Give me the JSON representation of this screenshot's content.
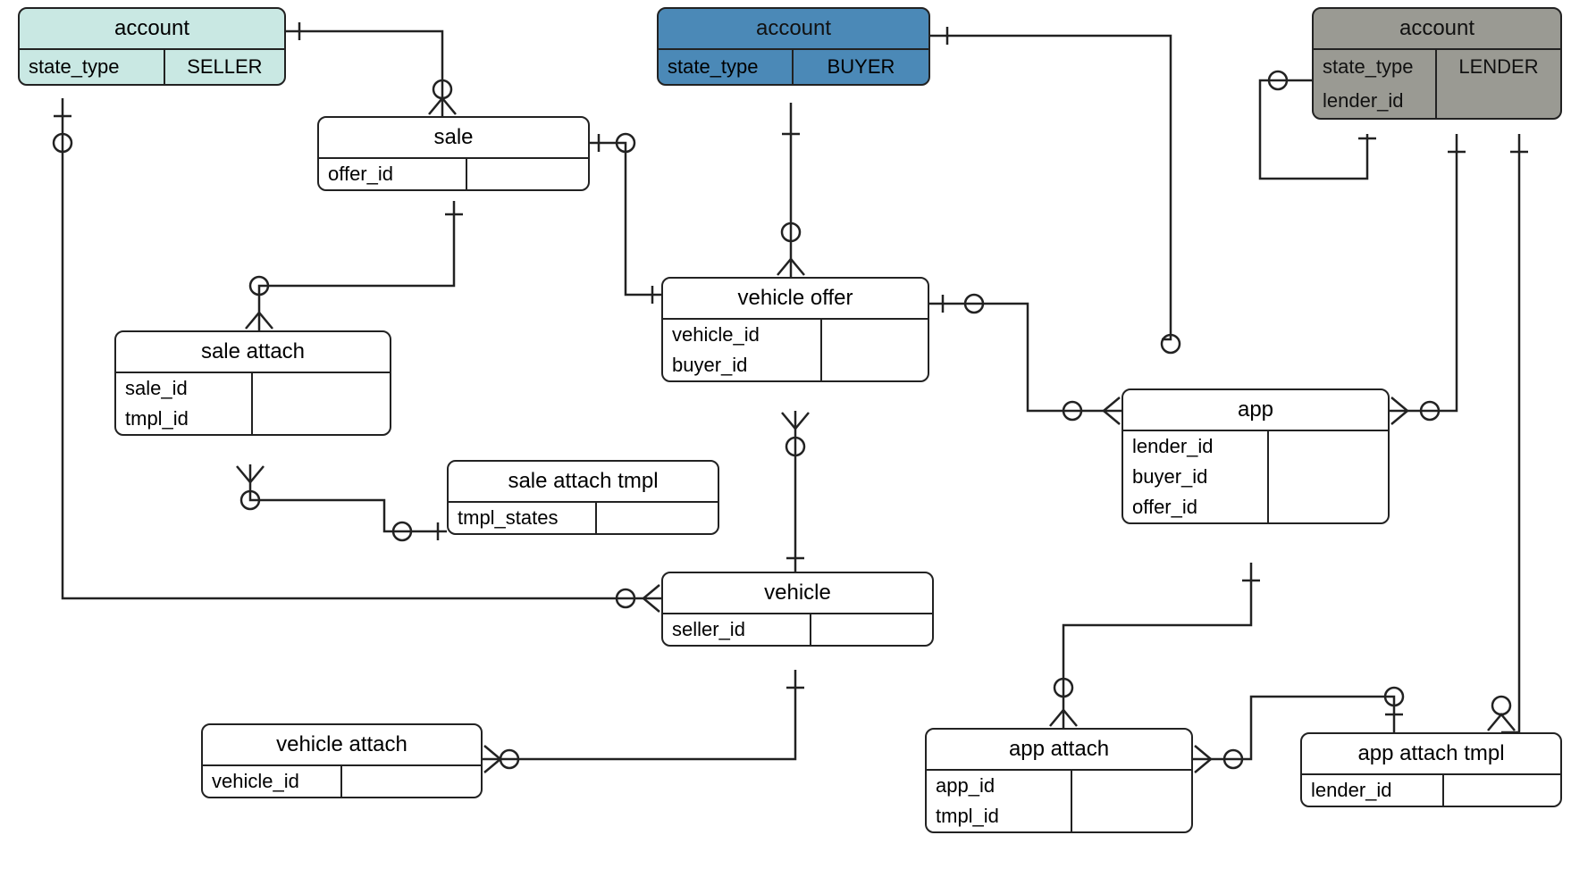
{
  "entities": {
    "account_seller": {
      "title": "account",
      "col1": "state_type",
      "col2": "SELLER"
    },
    "account_buyer": {
      "title": "account",
      "col1": "state_type",
      "col2": "BUYER"
    },
    "account_lender": {
      "title": "account",
      "col1": "state_type",
      "col2": "LENDER",
      "col1b": "lender_id"
    },
    "sale": {
      "title": "sale",
      "attr1": "offer_id"
    },
    "sale_attach": {
      "title": "sale attach",
      "attr1": "sale_id",
      "attr2": "tmpl_id"
    },
    "sale_attach_tmpl": {
      "title": "sale attach tmpl",
      "attr1": "tmpl_states"
    },
    "vehicle_offer": {
      "title": "vehicle offer",
      "attr1": "vehicle_id",
      "attr2": "buyer_id"
    },
    "vehicle": {
      "title": "vehicle",
      "attr1": "seller_id"
    },
    "vehicle_attach": {
      "title": "vehicle attach",
      "attr1": "vehicle_id"
    },
    "app": {
      "title": "app",
      "attr1": "lender_id",
      "attr2": "buyer_id",
      "attr3": "offer_id"
    },
    "app_attach": {
      "title": "app attach",
      "attr1": "app_id",
      "attr2": "tmpl_id"
    },
    "app_attach_tmpl": {
      "title": "app attach tmpl",
      "attr1": "lender_id"
    }
  },
  "relationships": [
    {
      "from": "account_seller",
      "to": "sale",
      "type": "one-to-many"
    },
    {
      "from": "sale",
      "to": "vehicle_offer",
      "type": "one-to-one-optional"
    },
    {
      "from": "sale",
      "to": "sale_attach",
      "type": "one-to-many-optional"
    },
    {
      "from": "sale_attach",
      "to": "sale_attach_tmpl",
      "type": "many-to-one-optional"
    },
    {
      "from": "account_seller",
      "to": "vehicle",
      "type": "one-to-many-optional"
    },
    {
      "from": "account_buyer",
      "to": "vehicle_offer",
      "type": "one-to-many-optional"
    },
    {
      "from": "vehicle_offer",
      "to": "vehicle",
      "type": "many-to-one-optional"
    },
    {
      "from": "vehicle",
      "to": "vehicle_attach",
      "type": "one-to-many-optional"
    },
    {
      "from": "vehicle_offer",
      "to": "app",
      "type": "one-to-many-optional"
    },
    {
      "from": "account_buyer",
      "to": "app",
      "type": "one-to-many-optional"
    },
    {
      "from": "account_lender",
      "to": "app",
      "type": "one-to-many-optional"
    },
    {
      "from": "account_lender",
      "to": "account_lender",
      "type": "self-optional"
    },
    {
      "from": "app",
      "to": "app_attach",
      "type": "one-to-many-optional"
    },
    {
      "from": "app_attach",
      "to": "app_attach_tmpl",
      "type": "many-to-one-optional"
    },
    {
      "from": "account_lender",
      "to": "app_attach_tmpl",
      "type": "one-to-many-optional"
    }
  ]
}
